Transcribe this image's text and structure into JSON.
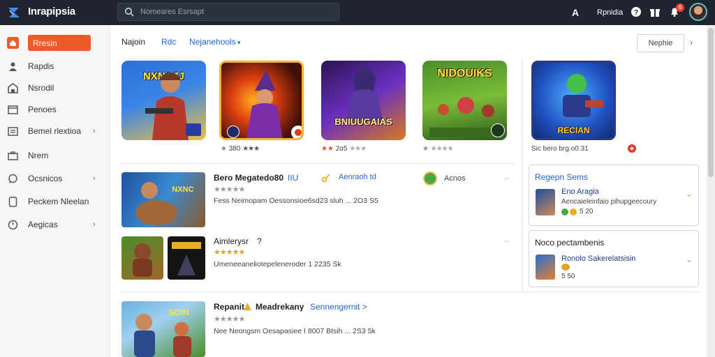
{
  "app": {
    "brand": "Inrapipsia",
    "search_placeholder": "Nomeares Esrsapt"
  },
  "topbar": {
    "letter": "A",
    "user": "Rpnidia",
    "notif_count": "6"
  },
  "sidebar": {
    "items": [
      {
        "label": "Rresin",
        "icon": "home-icon",
        "active": true
      },
      {
        "label": "Rapdis",
        "icon": "person-icon"
      },
      {
        "label": "Nsrodil",
        "icon": "store-icon"
      },
      {
        "label": "Penoes",
        "icon": "window-icon"
      },
      {
        "label": "Bemel rlextioa",
        "icon": "list-icon",
        "chevron": "›"
      },
      {
        "label": "Nrem",
        "icon": "briefcase-icon"
      },
      {
        "label": "Ocsnicos",
        "icon": "chat-icon",
        "chevron": "›"
      },
      {
        "label": "Peckem Nleelan",
        "icon": "document-icon"
      },
      {
        "label": "Aegicas",
        "icon": "clock-icon",
        "chevron": "›"
      }
    ]
  },
  "tabs": [
    {
      "label": "Najoin"
    },
    {
      "label": "Rdc",
      "style": "link"
    },
    {
      "label": "Nejanehools",
      "style": "link",
      "chevron": "▾"
    }
  ],
  "more_button": "Nephie",
  "featured": [
    {
      "title": "NXNAJJ",
      "rating": "380",
      "stars": "★★★"
    },
    {
      "title": "",
      "rating": "2ɑ5",
      "stars": "★★★"
    },
    {
      "title": "BNIUUGAIAS",
      "rating": "",
      "stars": "★★★★"
    },
    {
      "title": "NIDOUIKS",
      "rating": "",
      "stars": "★★★★"
    },
    {
      "title": "RECIAN",
      "caption": "Sic bero brg.o0:31"
    }
  ],
  "list": [
    {
      "title": "Bero Megatedo80",
      "badge": "IIU",
      "link": "Aenraoh td",
      "stars": "★★★★★",
      "desc": "Fess Neimopam Oessonsioe6sd23 sluh ... 2O3 S5",
      "publisher": "Acnos",
      "more": "·-"
    },
    {
      "title": "Aimlerysr",
      "badge": "?",
      "stars": "★★★★★",
      "desc": "Umeneeaneliotepeleneroder 1 2235 Sk",
      "more": "·-"
    },
    {
      "title": "Repanit",
      "badge": "Meadrekany",
      "link": "Sennengernit >",
      "stars": "★★★★★",
      "desc": "Nee Neongsm Oesapasiee I 8007 Btsih ... 2S3 5k"
    }
  ],
  "cards": [
    {
      "heading": "Regepn Sems",
      "item_title": "Eno Aragia",
      "item_desc": "Aencaieleinfaio pihupgeecoury",
      "item_meta": "5 20"
    },
    {
      "heading": "Noco pectambenis",
      "item_title": "Ronolo Sakerelatsisin",
      "item_meta": "5 50"
    }
  ],
  "colors": {
    "accent": "#f05a28",
    "topbar": "#1f2430",
    "link": "#2266cc"
  }
}
